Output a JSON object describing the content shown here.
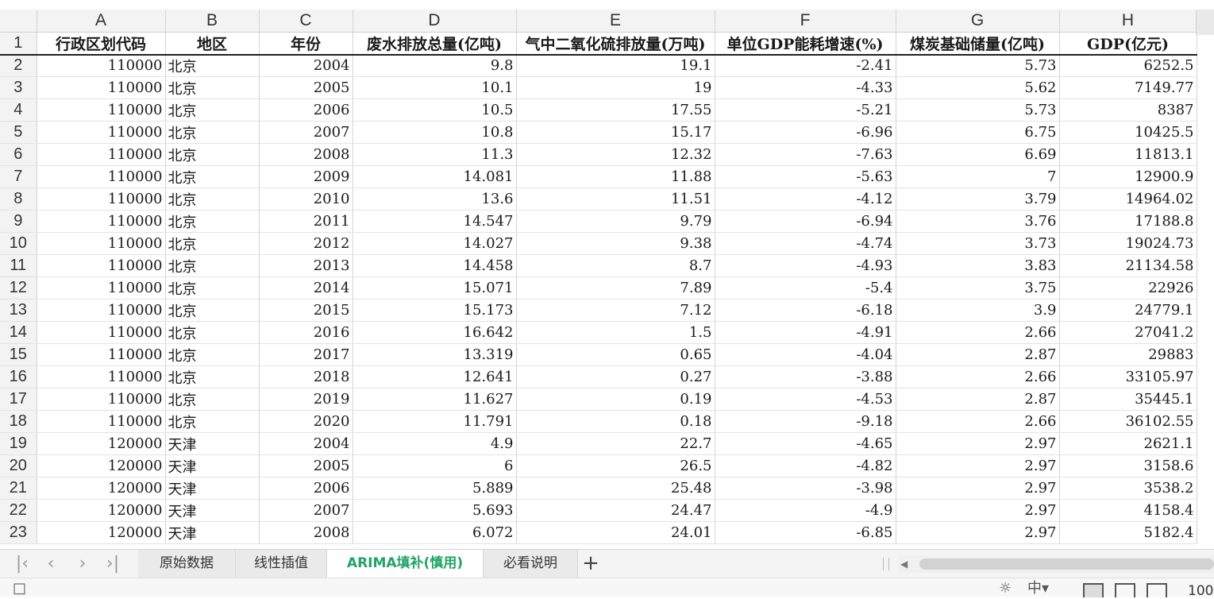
{
  "columns": [
    "A",
    "B",
    "C",
    "D",
    "E",
    "F",
    "G",
    "H"
  ],
  "headers": [
    "行政区划代码",
    "地区",
    "年份",
    "废水排放总量(亿吨)",
    "气中二氧化硫排放量(万吨)",
    "单位GDP能耗增速(%)",
    "煤炭基础储量(亿吨)",
    "GDP(亿元)"
  ],
  "rows": [
    [
      "110000",
      "北京",
      "2004",
      "9.8",
      "19.1",
      "-2.41",
      "5.73",
      "6252.5"
    ],
    [
      "110000",
      "北京",
      "2005",
      "10.1",
      "19",
      "-4.33",
      "5.62",
      "7149.77"
    ],
    [
      "110000",
      "北京",
      "2006",
      "10.5",
      "17.55",
      "-5.21",
      "5.73",
      "8387"
    ],
    [
      "110000",
      "北京",
      "2007",
      "10.8",
      "15.17",
      "-6.96",
      "6.75",
      "10425.5"
    ],
    [
      "110000",
      "北京",
      "2008",
      "11.3",
      "12.32",
      "-7.63",
      "6.69",
      "11813.1"
    ],
    [
      "110000",
      "北京",
      "2009",
      "14.081",
      "11.88",
      "-5.63",
      "7",
      "12900.9"
    ],
    [
      "110000",
      "北京",
      "2010",
      "13.6",
      "11.51",
      "-4.12",
      "3.79",
      "14964.02"
    ],
    [
      "110000",
      "北京",
      "2011",
      "14.547",
      "9.79",
      "-6.94",
      "3.76",
      "17188.8"
    ],
    [
      "110000",
      "北京",
      "2012",
      "14.027",
      "9.38",
      "-4.74",
      "3.73",
      "19024.73"
    ],
    [
      "110000",
      "北京",
      "2013",
      "14.458",
      "8.7",
      "-4.93",
      "3.83",
      "21134.58"
    ],
    [
      "110000",
      "北京",
      "2014",
      "15.071",
      "7.89",
      "-5.4",
      "3.75",
      "22926"
    ],
    [
      "110000",
      "北京",
      "2015",
      "15.173",
      "7.12",
      "-6.18",
      "3.9",
      "24779.1"
    ],
    [
      "110000",
      "北京",
      "2016",
      "16.642",
      "1.5",
      "-4.91",
      "2.66",
      "27041.2"
    ],
    [
      "110000",
      "北京",
      "2017",
      "13.319",
      "0.65",
      "-4.04",
      "2.87",
      "29883"
    ],
    [
      "110000",
      "北京",
      "2018",
      "12.641",
      "0.27",
      "-3.88",
      "2.66",
      "33105.97"
    ],
    [
      "110000",
      "北京",
      "2019",
      "11.627",
      "0.19",
      "-4.53",
      "2.87",
      "35445.1"
    ],
    [
      "110000",
      "北京",
      "2020",
      "11.791",
      "0.18",
      "-9.18",
      "2.66",
      "36102.55"
    ],
    [
      "120000",
      "天津",
      "2004",
      "4.9",
      "22.7",
      "-4.65",
      "2.97",
      "2621.1"
    ],
    [
      "120000",
      "天津",
      "2005",
      "6",
      "26.5",
      "-4.82",
      "2.97",
      "3158.6"
    ],
    [
      "120000",
      "天津",
      "2006",
      "5.889",
      "25.48",
      "-3.98",
      "2.97",
      "3538.2"
    ],
    [
      "120000",
      "天津",
      "2007",
      "5.693",
      "24.47",
      "-4.9",
      "2.97",
      "4158.4"
    ],
    [
      "120000",
      "天津",
      "2008",
      "6.072",
      "24.01",
      "-6.85",
      "2.97",
      "5182.4"
    ]
  ],
  "sheet_tabs": [
    {
      "label": "原始数据",
      "active": false
    },
    {
      "label": "线性插值",
      "active": false
    },
    {
      "label": "ARIMA填补(慎用)",
      "active": true
    },
    {
      "label": "必看说明",
      "active": false
    }
  ],
  "add_tab_label": "+",
  "zoom_text": "100",
  "colors": {
    "active_tab": "#21a366",
    "header_bg": "#f3f3f3",
    "grid_line": "#d4d4d4"
  }
}
